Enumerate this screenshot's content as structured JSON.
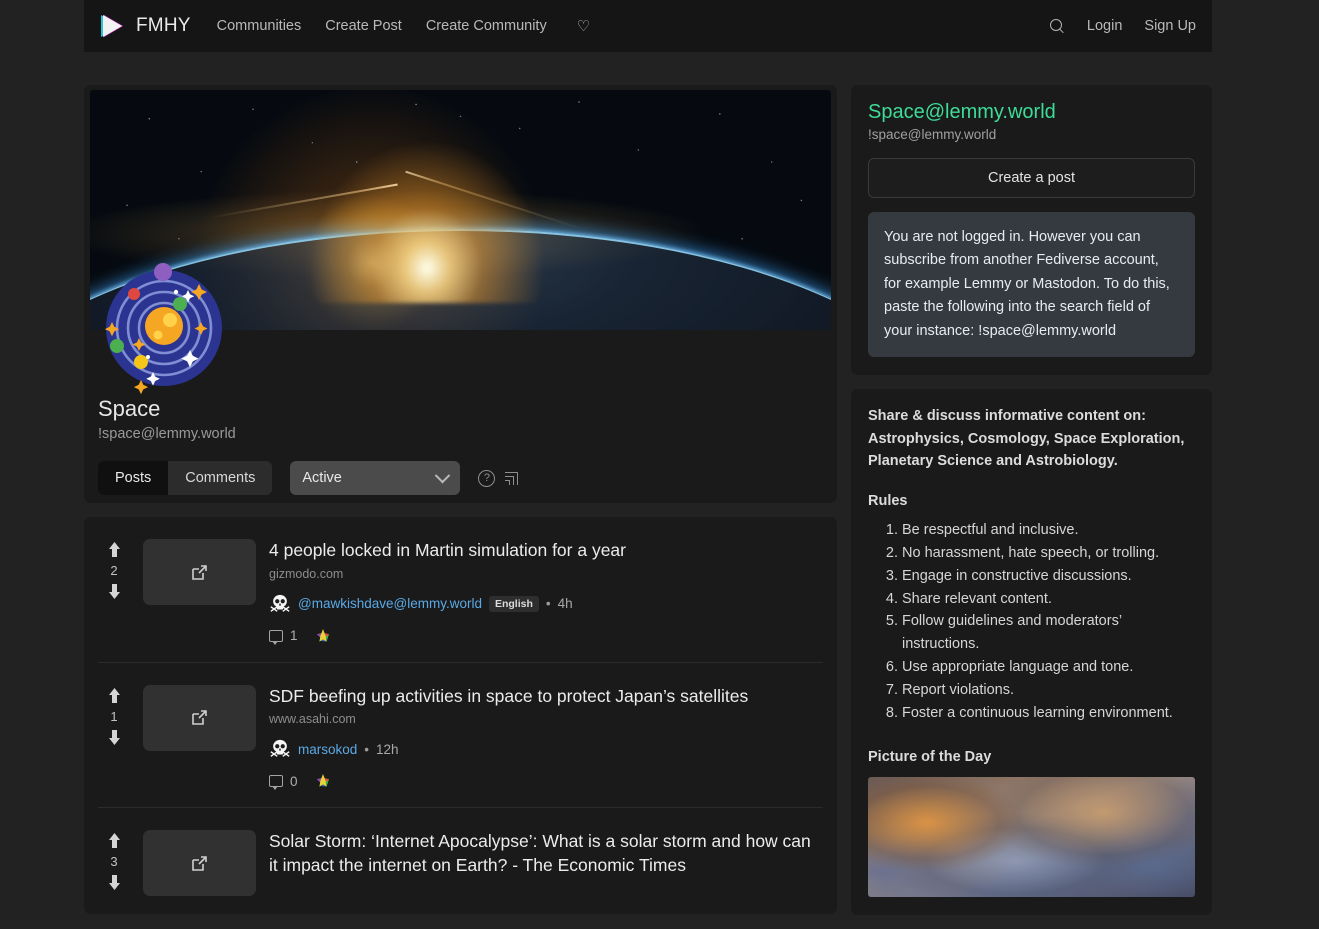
{
  "navbar": {
    "logo_icon": "play-triangle-logo",
    "brand": "FMHY",
    "links": [
      {
        "label": "Communities"
      },
      {
        "label": "Create Post"
      },
      {
        "label": "Create Community"
      }
    ],
    "heart_icon": "heart-icon",
    "search_icon": "search-icon",
    "login": "Login",
    "signup": "Sign Up"
  },
  "community": {
    "banner_image": "earth-sunrise-from-space",
    "avatar_icon": "solar-system-avatar",
    "name": "Space",
    "handle": "!space@lemmy.world",
    "tabs": [
      {
        "label": "Posts",
        "active": true
      },
      {
        "label": "Comments",
        "active": false
      }
    ],
    "sort": {
      "value": "Active",
      "chevron_icon": "chevron-down-icon"
    },
    "help_icon": "question-circle-icon",
    "rss_icon": "rss-icon"
  },
  "posts": [
    {
      "score": "2",
      "title": "4 people locked in Martin simulation for a year",
      "url": "gizmodo.com",
      "avatar_icon": "skull-crossbones-avatar",
      "author": "@mawkishdave@lemmy.world",
      "language": "English",
      "separator": "•",
      "age": "4h",
      "comments": "1",
      "comment_icon": "comment-icon",
      "fediverse_icon": "fediverse-star-icon",
      "thumb_icon": "external-link-icon",
      "up_icon": "arrow-up-icon",
      "down_icon": "arrow-down-icon"
    },
    {
      "score": "1",
      "title": "SDF beefing up activities in space to protect Japan’s satellites",
      "url": "www.asahi.com",
      "avatar_icon": "skull-crossbones-avatar",
      "author": "marsokod",
      "language": "",
      "separator": "•",
      "age": "12h",
      "comments": "0",
      "comment_icon": "comment-icon",
      "fediverse_icon": "fediverse-star-icon",
      "thumb_icon": "external-link-icon",
      "up_icon": "arrow-up-icon",
      "down_icon": "arrow-down-icon"
    },
    {
      "score": "3",
      "title": "Solar Storm: ‘Internet Apocalypse’: What is a solar storm and how can it impact the internet on Earth? - The Economic Times",
      "url": "",
      "avatar_icon": "skull-crossbones-avatar",
      "author": "",
      "language": "",
      "separator": "•",
      "age": "",
      "comments": "",
      "comment_icon": "comment-icon",
      "fediverse_icon": "fediverse-star-icon",
      "thumb_icon": "external-link-icon",
      "up_icon": "arrow-up-icon",
      "down_icon": "arrow-down-icon"
    }
  ],
  "sidebar": {
    "title": "Space@lemmy.world",
    "handle": "!space@lemmy.world",
    "create_post": "Create a post",
    "notice": "You are not logged in. However you can subscribe from another Fediverse account, for example Lemmy or Mastodon. To do this, paste the following into the search field of your instance: !space@lemmy.world",
    "description": "Share & discuss informative content on: Astrophysics, Cosmology, Space Exploration, Planetary Science and Astrobiology.",
    "rules_heading": "Rules",
    "rules": [
      "Be respectful and inclusive.",
      "No harassment, hate speech, or trolling.",
      "Engage in constructive discussions.",
      "Share relevant content.",
      "Follow guidelines and moderators’ instructions.",
      "Use appropriate language and tone.",
      "Report violations.",
      "Foster a continuous learning environment."
    ],
    "potd_heading": "Picture of the Day",
    "potd_image": "nebula-photograph"
  },
  "colors": {
    "page_bg": "#222222",
    "card_bg": "#1a1a1a",
    "navbar_bg": "#151515",
    "accent_green": "#3ddc97",
    "link_blue": "#5aa9e6",
    "notice_bg": "#343a40"
  }
}
